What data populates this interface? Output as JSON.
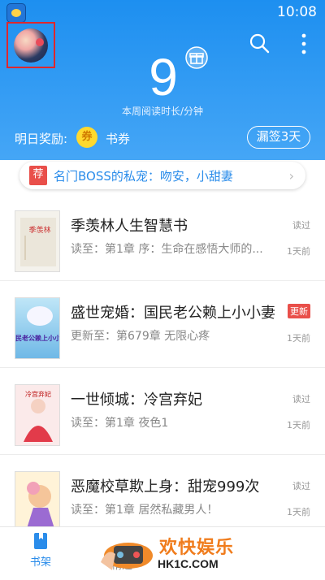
{
  "status_bar": {
    "time": "10:08"
  },
  "header": {
    "weekly_minutes": "9",
    "weekly_label": "本周阅读时长/分钟",
    "reward_label": "明日奖励:",
    "coupon_badge": "券",
    "coupon_text": "书券",
    "checkin_button": "漏签3天"
  },
  "banner": {
    "tag": "荐",
    "text": "名门BOSS的私宠：吻安，小甜妻"
  },
  "books": [
    {
      "title": "季羡林人生智慧书",
      "progress": "读至：第1章 序：生命在感悟大师的...",
      "status": "读过",
      "time": "1天前",
      "cover_text": "季羡林"
    },
    {
      "title": "盛世宠婚：国民老公赖上小小妻",
      "progress": "更新至：第679章 无限心疼",
      "status": "更新",
      "time": "1天前",
      "cover_text": "国民老公赖上小小妻"
    },
    {
      "title": "一世倾城：冷宫弃妃",
      "progress": "读至：第1章 夜色1",
      "status": "读过",
      "time": "1天前",
      "cover_text": "冷宫弃妃"
    },
    {
      "title": "恶魔校草欺上身：甜宠999次",
      "progress": "读至：第1章 居然私藏男人！",
      "status": "读过",
      "time": "1天前",
      "cover_text": ""
    }
  ],
  "bottom_nav": [
    {
      "label": "书架",
      "active": true
    },
    {
      "label": "精选",
      "active": false
    }
  ],
  "watermark": {
    "text": "欢快娱乐",
    "sub": "HK1C.COM"
  },
  "colors": {
    "header": "#1d8ff0",
    "accent": "#2a8cea",
    "badge_red": "#e94f4a",
    "coupon": "#ffd92f"
  }
}
